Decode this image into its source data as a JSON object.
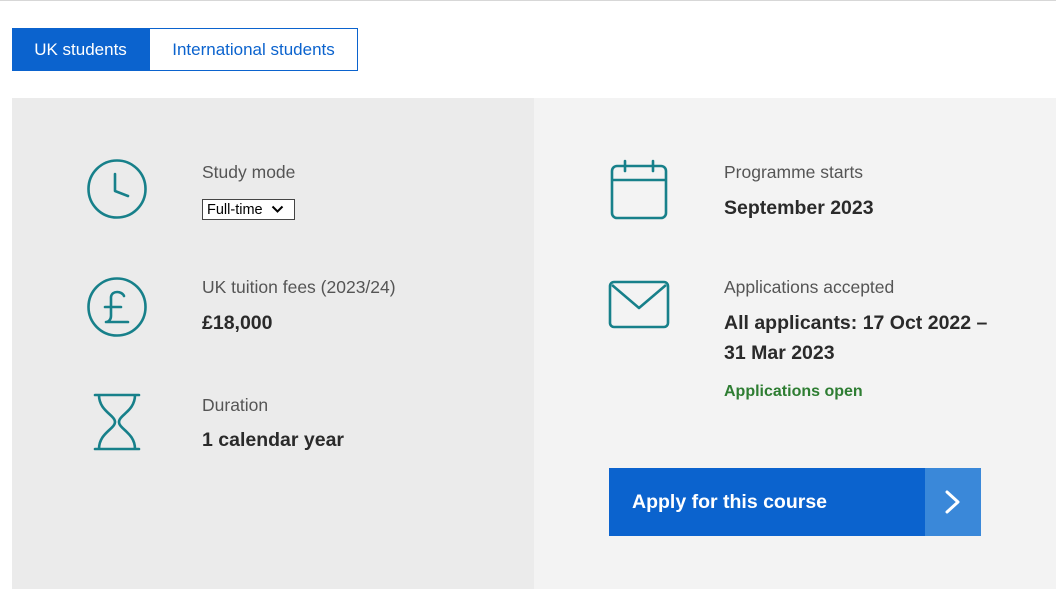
{
  "tabs": [
    {
      "label": "UK students",
      "active": true
    },
    {
      "label": "International students",
      "active": false
    }
  ],
  "study_mode": {
    "label": "Study mode",
    "selected": "Full-time",
    "icon": "clock-icon"
  },
  "fees": {
    "label": "UK tuition fees (2023/24)",
    "value": "£18,000",
    "icon": "pound-icon"
  },
  "duration": {
    "label": "Duration",
    "value": "1 calendar year",
    "icon": "hourglass-icon"
  },
  "programme_starts": {
    "label": "Programme starts",
    "value": "September 2023",
    "icon": "calendar-icon"
  },
  "applications": {
    "label": "Applications accepted",
    "value_line1": "All applicants: 17 Oct 2022 –",
    "value_line2": "31 Mar 2023",
    "status": "Applications open",
    "icon": "envelope-icon"
  },
  "apply_button": {
    "label": "Apply for this course",
    "icon": "chevron-right-icon"
  },
  "colors": {
    "accent_blue": "#0b63ce",
    "icon_teal": "#17808a",
    "status_green": "#2e7d32",
    "left_panel_bg": "#ebebeb",
    "right_panel_bg": "#f3f3f3"
  }
}
